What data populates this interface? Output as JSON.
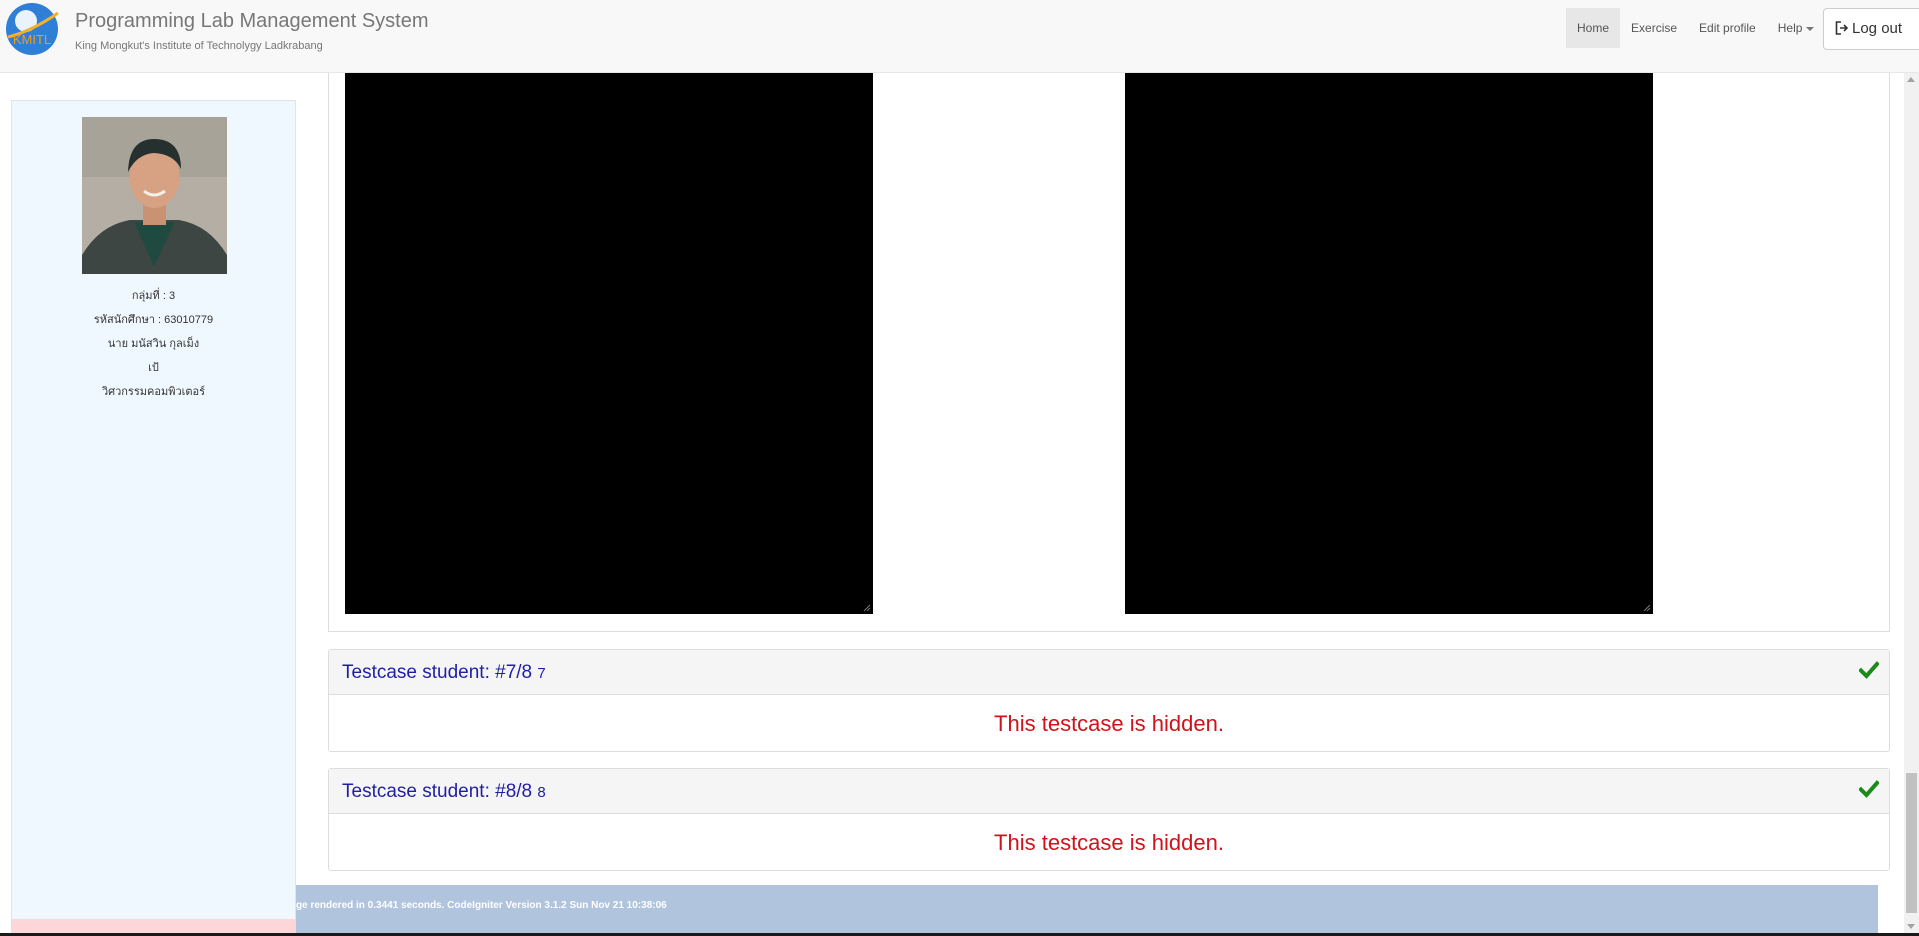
{
  "header": {
    "title": "Programming Lab Management System",
    "subtitle": "King Mongkut's Institute of Technolygy Ladkrabang",
    "logo_text": "KMITL",
    "nav": [
      {
        "label": "Home",
        "active": true
      },
      {
        "label": "Exercise"
      },
      {
        "label": "Edit profile"
      },
      {
        "label": "Help"
      }
    ],
    "logout_label": "Log out"
  },
  "sidebar": {
    "group": "กลุ่มที่ : 3",
    "student_id": "รหัสนักศึกษา : 63010779",
    "name": "นาย มนัสวิน กุลเม็ง",
    "nickname": "เป้",
    "department": "วิศวกรรมคอมพิวเตอร์"
  },
  "testcases": [
    {
      "title": "Testcase student: #7/8",
      "number": "7",
      "status": "passed",
      "message": "This testcase is hidden."
    },
    {
      "title": "Testcase student: #8/8",
      "number": "8",
      "status": "passed",
      "message": "This testcase is hidden."
    }
  ],
  "footer": {
    "text": "ge rendered in 0.3441 seconds. CodeIgniter Version 3.1.2 Sun Nov 21 10:38:06"
  },
  "colors": {
    "testcase_title": "#1f1fa6",
    "hidden_message": "#d0121b",
    "check_icon": "#1a8a1a",
    "footer_bg": "#b0c4de",
    "sidebar_bg": "#f0f8ff"
  }
}
